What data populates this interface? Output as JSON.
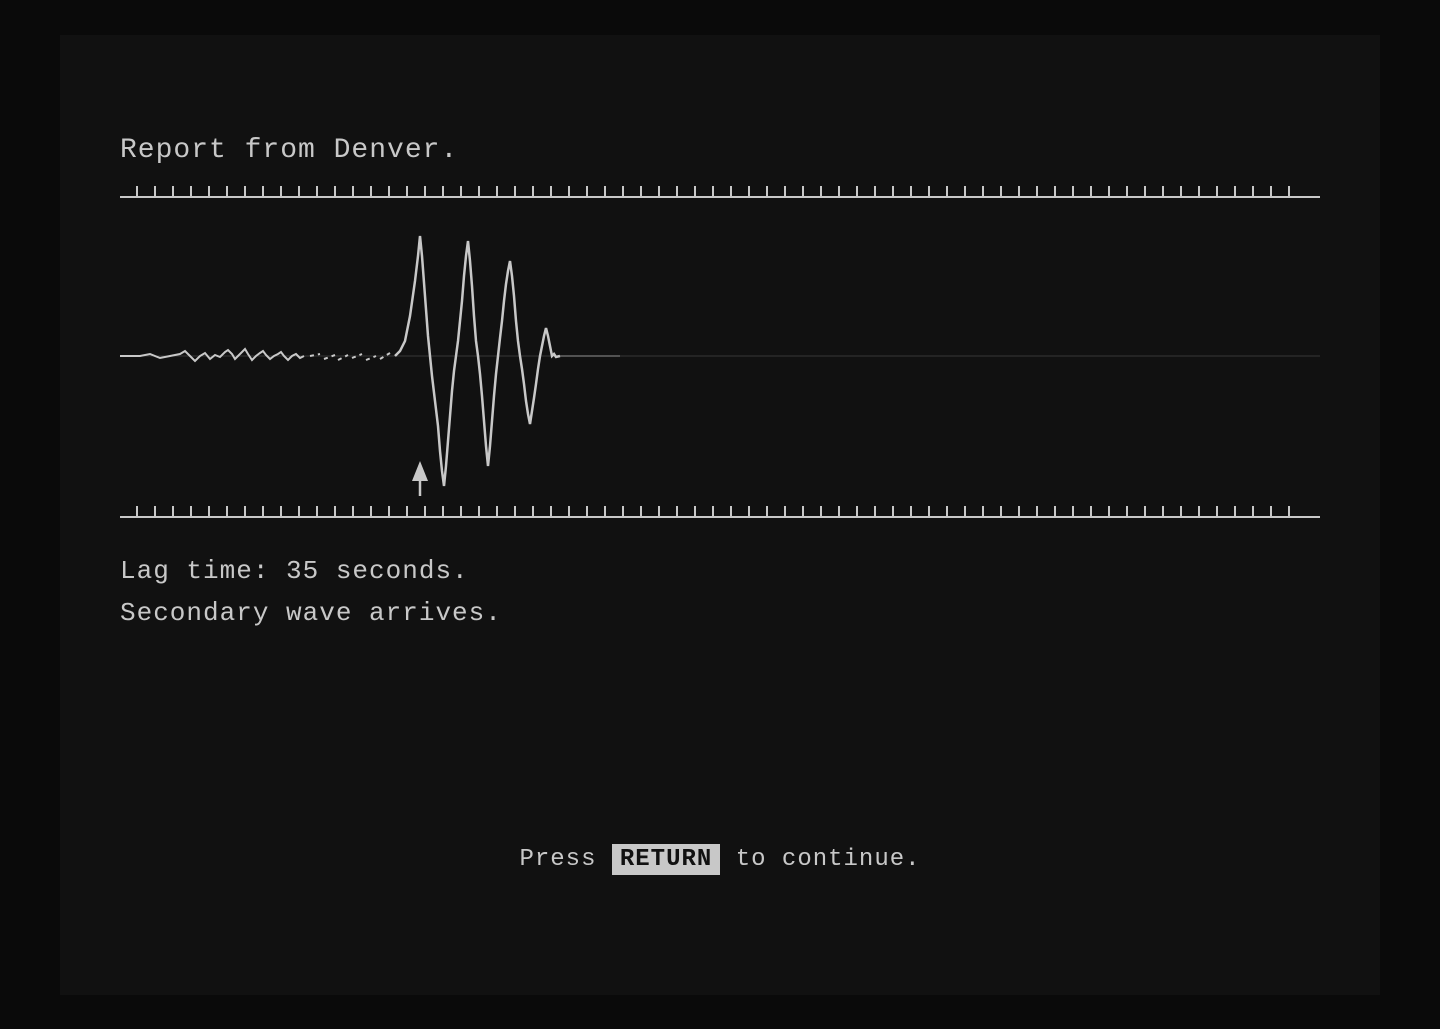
{
  "screen": {
    "title": "Report from Denver.",
    "lag_time_label": "Lag time: 35 seconds.",
    "secondary_wave_label": "Secondary wave arrives.",
    "press_label": "Press",
    "return_key_label": "RETURN",
    "continue_label": " to continue.",
    "ruler": {
      "tick_count": 65
    }
  }
}
